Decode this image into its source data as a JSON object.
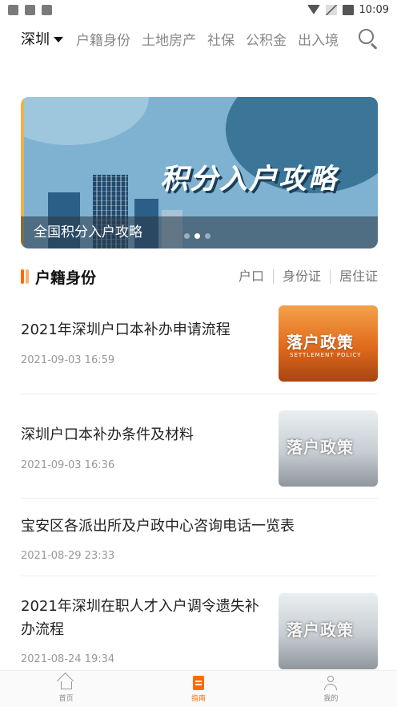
{
  "status_bar": {
    "time": "10:09",
    "left_icons": [
      "notification-icon",
      "app-icon",
      "message-icon"
    ],
    "right_icons": [
      "wifi-icon",
      "no-signal-icon",
      "battery-icon"
    ]
  },
  "top_nav": {
    "city": "深圳",
    "tabs": [
      "户籍身份",
      "土地房产",
      "社保",
      "公积金",
      "出入境"
    ],
    "search_icon": "search-icon"
  },
  "banner": {
    "title": "积分入户攻略",
    "caption": "全国积分入户攻略",
    "dots": 3,
    "active_dot": 1
  },
  "section": {
    "title": "户籍身份",
    "tabs": [
      "户口",
      "身份证",
      "居住证"
    ]
  },
  "news": [
    {
      "title": "2021年深圳户口本补办申请流程",
      "date": "2021-09-03 16:59",
      "thumb_text": "落户政策",
      "thumb_sub": "SETTLEMENT POLICY",
      "thumb_style": "orange"
    },
    {
      "title": "深圳户口本补办条件及材料",
      "date": "2021-09-03 16:36",
      "thumb_text": "落户政策",
      "thumb_sub": "",
      "thumb_style": "grey"
    },
    {
      "title": "宝安区各派出所及户政中心咨询电话一览表",
      "date": "2021-08-29 23:33"
    },
    {
      "title": "2021年深圳在职人才入户调令遗失补办流程",
      "date": "2021-08-24 19:34",
      "thumb_text": "落户政策",
      "thumb_sub": "",
      "thumb_style": "grey"
    }
  ],
  "bottom_nav": {
    "items": [
      {
        "label": "首页",
        "icon": "home-icon"
      },
      {
        "label": "指南",
        "icon": "guide-icon"
      },
      {
        "label": "我的",
        "icon": "profile-icon"
      }
    ],
    "active_index": 1
  },
  "colors": {
    "accent": "#ff6a00",
    "banner_bg": "#7fb2d0",
    "banner_dark": "#1f4a6e"
  }
}
